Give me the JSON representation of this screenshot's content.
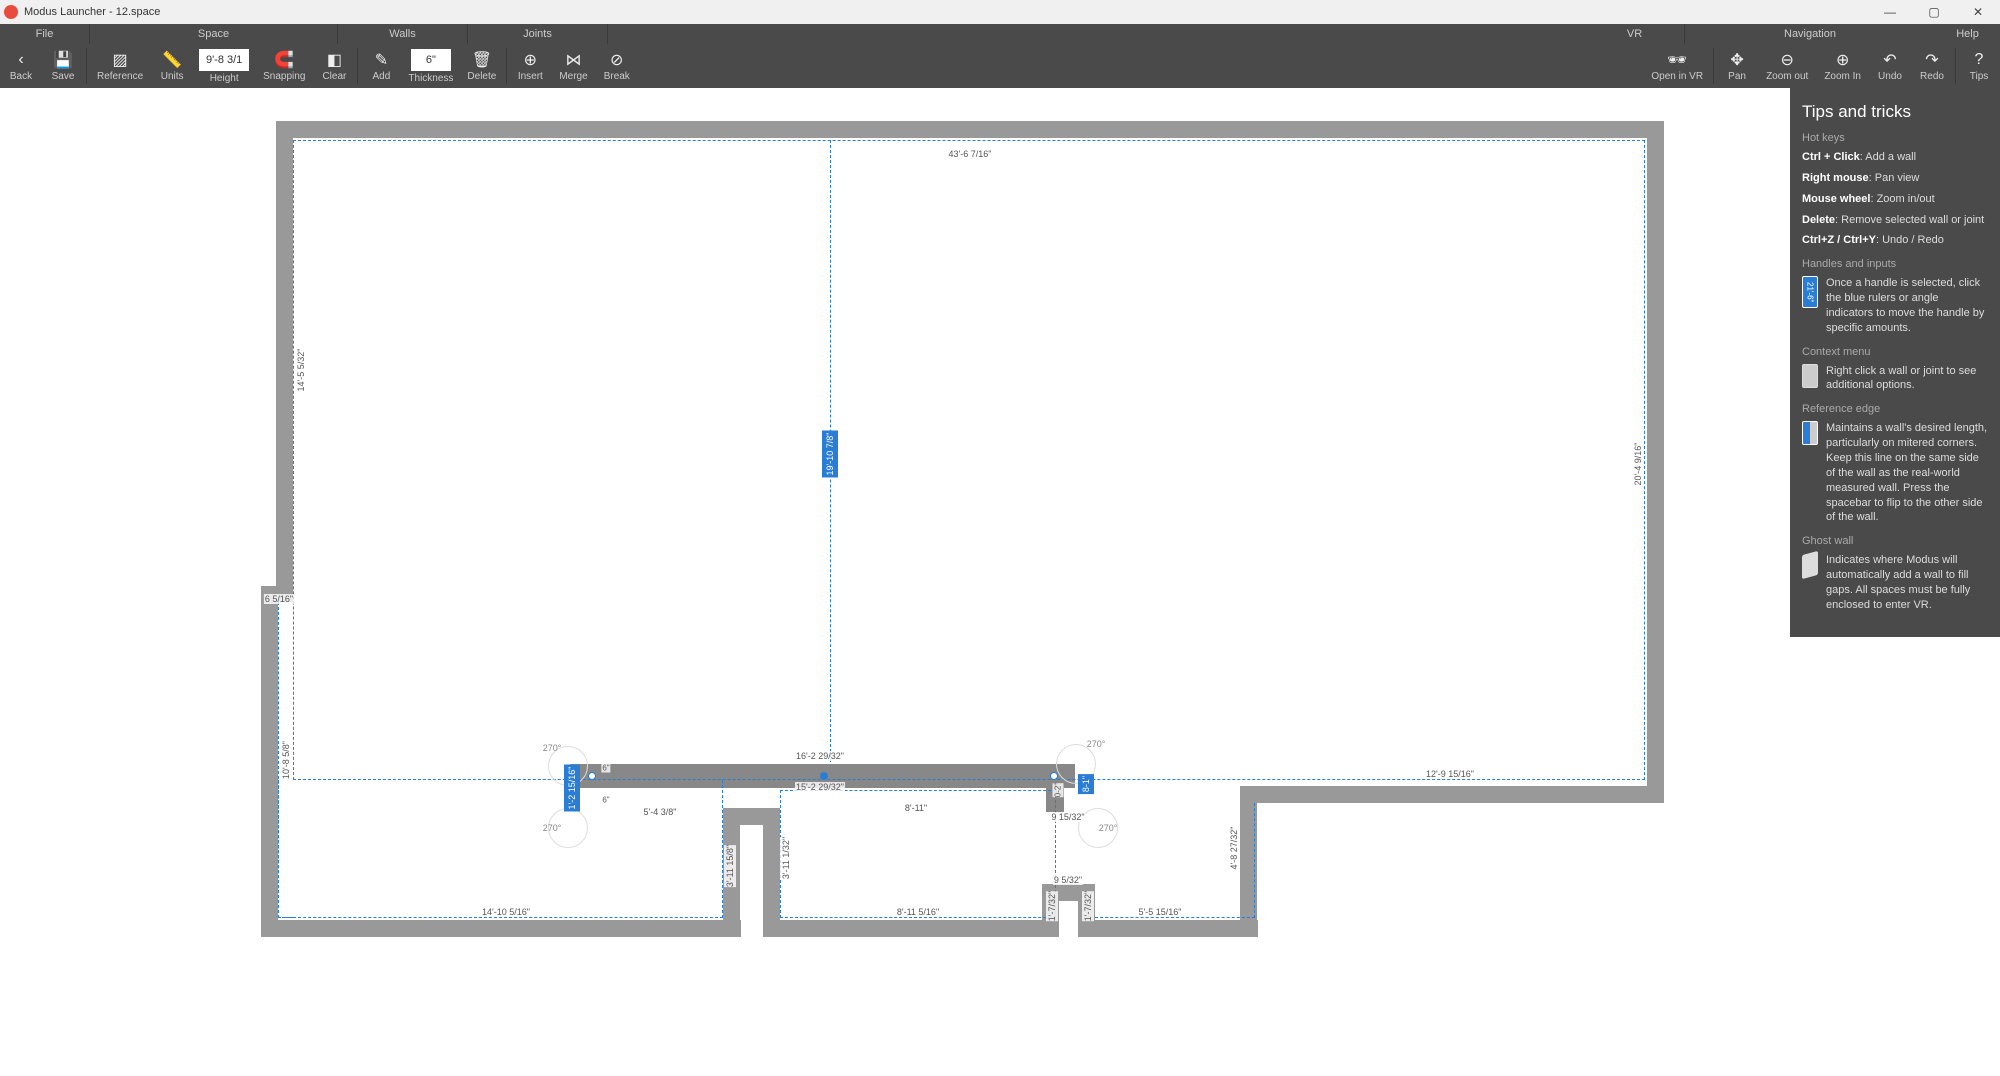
{
  "window": {
    "title": "Modus Launcher - 12.space"
  },
  "menu": {
    "file": "File",
    "space": "Space",
    "walls": "Walls",
    "joints": "Joints",
    "vr": "VR",
    "nav": "Navigation",
    "help": "Help"
  },
  "toolbar": {
    "back": "Back",
    "save": "Save",
    "reference": "Reference",
    "units": "Units",
    "height_label": "Height",
    "height_value": "9'-8 3/1",
    "snapping": "Snapping",
    "clear": "Clear",
    "add": "Add",
    "thickness_label": "Thickness",
    "thickness_value": "6\"",
    "delete": "Delete",
    "insert": "Insert",
    "merge": "Merge",
    "break": "Break",
    "open_vr": "Open in VR",
    "pan": "Pan",
    "zoom_out": "Zoom out",
    "zoom_in": "Zoom In",
    "undo": "Undo",
    "redo": "Redo",
    "tips": "Tips"
  },
  "dimensions": {
    "top": "43'-6 7/16\"",
    "left_upper": "14'-5 5/32\"",
    "left_jog": "6 5/16\"",
    "left_lower": "10'-8 5/8\"",
    "right": "20'-4 9/16\"",
    "center_vert": "19'-10 7/8\"",
    "int_top": "16'-2 29/32\"",
    "int_below": "15'-2 29/32\"",
    "int_far_right": "12'-9 15/16\"",
    "int_left_seg": "5'-4 3/8\"",
    "int_mid_seg": "8'-11\"",
    "int_r_bot": "5'-5 15/16\"",
    "int_m_bot": "8'-11 5/16\"",
    "int_l_bot": "14'-10 5/16\"",
    "int_r_small": "9 15/32\"",
    "int_r_step": "9 5/32\"",
    "left_col_h": "3'-11 15/8\"",
    "mid_col_h": "3'-11 1/32\"",
    "r_col_h": "4'-8 27/32\"",
    "sel_h": "1'-2 15/16\"",
    "door_v1": "1'-7/32\"",
    "door_v2": "1'-7/32\"",
    "sel_r": "8-1\"",
    "tiny6": "6\"",
    "tiny62": "6\"",
    "a2": "0-2\""
  },
  "angles": {
    "a270_1": "270°",
    "a270_2": "270°",
    "a270_3": "270°",
    "a270_4": "270°"
  },
  "tips": {
    "title": "Tips and tricks",
    "hotkeys_h": "Hot keys",
    "hk1b": "Ctrl + Click",
    "hk1": ": Add a wall",
    "hk2b": "Right mouse",
    "hk2": ": Pan view",
    "hk3b": "Mouse wheel",
    "hk3": ": Zoom in/out",
    "hk4b": "Delete",
    "hk4": ": Remove selected wall or joint",
    "hk5b": "Ctrl+Z / Ctrl+Y",
    "hk5": ": Undo / Redo",
    "handles_h": "Handles and inputs",
    "handles_t": "Once a handle is selected, click the blue rulers or angle indicators to move the handle by specific amounts.",
    "ctx_h": "Context menu",
    "ctx_t": "Right click a wall or joint to see additional options.",
    "ref_h": "Reference edge",
    "ref_t": "Maintains a wall's desired length, particularly on mitered corners. Keep this line on the same side of the wall as the real-world measured wall. Press the spacebar to flip to the other side of the wall.",
    "ghost_h": "Ghost wall",
    "ghost_t": "Indicates where Modus will automatically add a wall to fill gaps. All spaces must be fully enclosed to enter VR.",
    "thumb_label": "21'-6\""
  }
}
